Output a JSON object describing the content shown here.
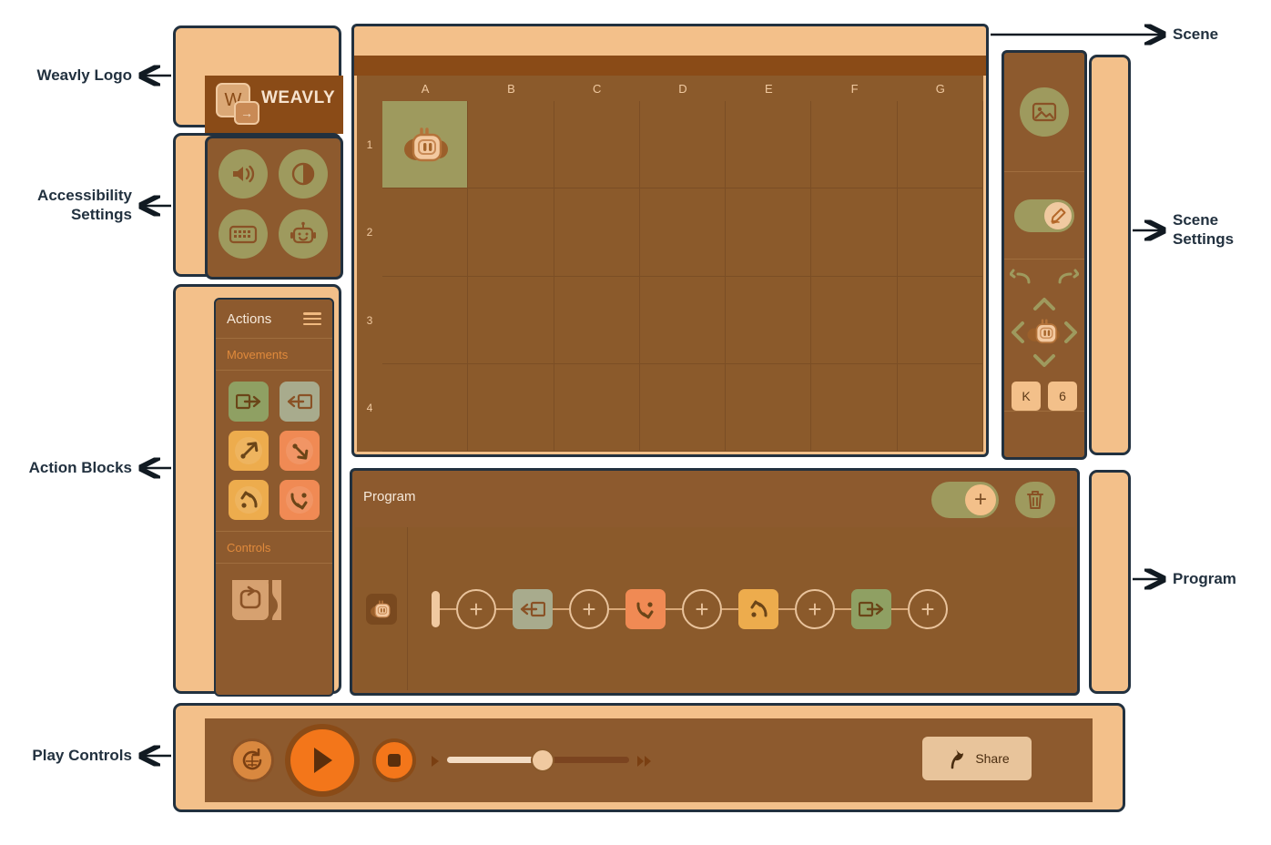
{
  "annotations": {
    "left": [
      {
        "id": "weavly-logo",
        "label": "Weavly Logo"
      },
      {
        "id": "accessibility-settings",
        "label": "Accessibility\nSettings"
      },
      {
        "id": "action-blocks",
        "label": "Action Blocks"
      },
      {
        "id": "play-controls",
        "label": "Play Controls"
      }
    ],
    "right": [
      {
        "id": "scene",
        "label": "Scene"
      },
      {
        "id": "scene-settings",
        "label": "Scene\nSettings"
      },
      {
        "id": "program",
        "label": "Program"
      }
    ]
  },
  "logo": {
    "wordmark": "WEAVLY",
    "mark_letter": "W",
    "badge_icon": "arrow-right-icon"
  },
  "accessibility": {
    "buttons": [
      {
        "name": "sound-toggle",
        "icon": "speaker-icon"
      },
      {
        "name": "contrast-toggle",
        "icon": "contrast-icon"
      },
      {
        "name": "keyboard-shortcuts",
        "icon": "keyboard-icon"
      },
      {
        "name": "character-select",
        "icon": "robot-face-icon"
      }
    ]
  },
  "actions": {
    "title": "Actions",
    "menu_icon": "hamburger-icon",
    "sections": [
      {
        "title": "Movements",
        "blocks": [
          {
            "name": "forward-block",
            "icon": "arrow-right-box-icon",
            "color": "#8fa063",
            "style": "green"
          },
          {
            "name": "backward-block",
            "icon": "arrow-left-box-icon",
            "color": "#a8ab8d",
            "style": "olive"
          },
          {
            "name": "turn-left-45-block",
            "icon": "turn-left-45-icon",
            "color": "#edac4d",
            "style": "yellow"
          },
          {
            "name": "turn-right-45-block",
            "icon": "turn-right-45-icon",
            "color": "#f08a54",
            "style": "orange"
          },
          {
            "name": "turn-left-90-block",
            "icon": "turn-left-90-icon",
            "color": "#edac4d",
            "style": "yellow"
          },
          {
            "name": "turn-right-90-block",
            "icon": "turn-right-90-icon",
            "color": "#f08a54",
            "style": "orange"
          }
        ]
      },
      {
        "title": "Controls",
        "blocks": [
          {
            "name": "loop-block",
            "icon": "loop-icon",
            "color": "#d6a170",
            "style": "loop"
          }
        ]
      }
    ]
  },
  "scene": {
    "columns": [
      "A",
      "B",
      "C",
      "D",
      "E",
      "F",
      "G"
    ],
    "rows": [
      "1",
      "2",
      "3",
      "4"
    ],
    "character": {
      "name": "robot-character",
      "column": "A",
      "row": "1",
      "icon": "robot-icon"
    }
  },
  "scene_settings": {
    "background_button": {
      "name": "scene-image-button",
      "icon": "image-icon"
    },
    "edit_toggle": {
      "name": "scene-edit-toggle",
      "icon": "pencil-icon",
      "state": "on"
    },
    "undo": {
      "name": "undo-button",
      "icon": "undo-icon"
    },
    "redo": {
      "name": "redo-button",
      "icon": "redo-icon"
    },
    "dpad": {
      "up": "chevron-up-icon",
      "down": "chevron-down-icon",
      "left": "chevron-left-icon",
      "right": "chevron-right-icon",
      "center": "robot-icon"
    },
    "coordinate_buttons": [
      {
        "name": "column-label-button",
        "label": "K"
      },
      {
        "name": "row-label-button",
        "label": "6"
      }
    ]
  },
  "program": {
    "title": "Program",
    "add_toggle": {
      "name": "add-node-toggle",
      "icon": "plus-icon"
    },
    "delete_all": {
      "name": "delete-all-button",
      "icon": "trash-icon"
    },
    "character_chip": {
      "name": "program-character-chip",
      "icon": "robot-icon"
    },
    "sequence": [
      {
        "type": "add",
        "name": "add-node",
        "icon": "plus-icon"
      },
      {
        "type": "block",
        "name": "backward-block",
        "icon": "arrow-left-box-icon",
        "style": "olive",
        "color": "#a8ab8d"
      },
      {
        "type": "add",
        "name": "add-node",
        "icon": "plus-icon"
      },
      {
        "type": "block",
        "name": "turn-right-90-block",
        "icon": "turn-right-90-icon",
        "style": "orange",
        "color": "#f08a54"
      },
      {
        "type": "add",
        "name": "add-node",
        "icon": "plus-icon"
      },
      {
        "type": "block",
        "name": "turn-left-90-block",
        "icon": "turn-left-90-icon",
        "style": "yellow",
        "color": "#edac4d"
      },
      {
        "type": "add",
        "name": "add-node",
        "icon": "plus-icon"
      },
      {
        "type": "block",
        "name": "forward-block",
        "icon": "arrow-right-box-icon",
        "style": "green",
        "color": "#8fa063"
      },
      {
        "type": "add",
        "name": "add-node",
        "icon": "plus-icon"
      }
    ]
  },
  "play_controls": {
    "refresh": {
      "name": "refresh-button",
      "icon": "refresh-icon"
    },
    "play": {
      "name": "play-button",
      "icon": "play-icon"
    },
    "stop": {
      "name": "stop-button",
      "icon": "stop-icon"
    },
    "speed_slider": {
      "name": "speed-slider",
      "value_percent": 52,
      "min_icon": "play-triangle-icon",
      "max_icon": "fast-forward-icon"
    },
    "share": {
      "name": "share-button",
      "label": "Share",
      "icon": "share-icon"
    }
  },
  "colors": {
    "peach": "#f3c08a",
    "outline": "#22313f",
    "panel_brown": "#8d5a2e",
    "grid_brown": "#8b5a2b",
    "dark_brown": "#8a4b17",
    "accent_orange": "#f3761a",
    "olive": "#9e9a5e"
  }
}
